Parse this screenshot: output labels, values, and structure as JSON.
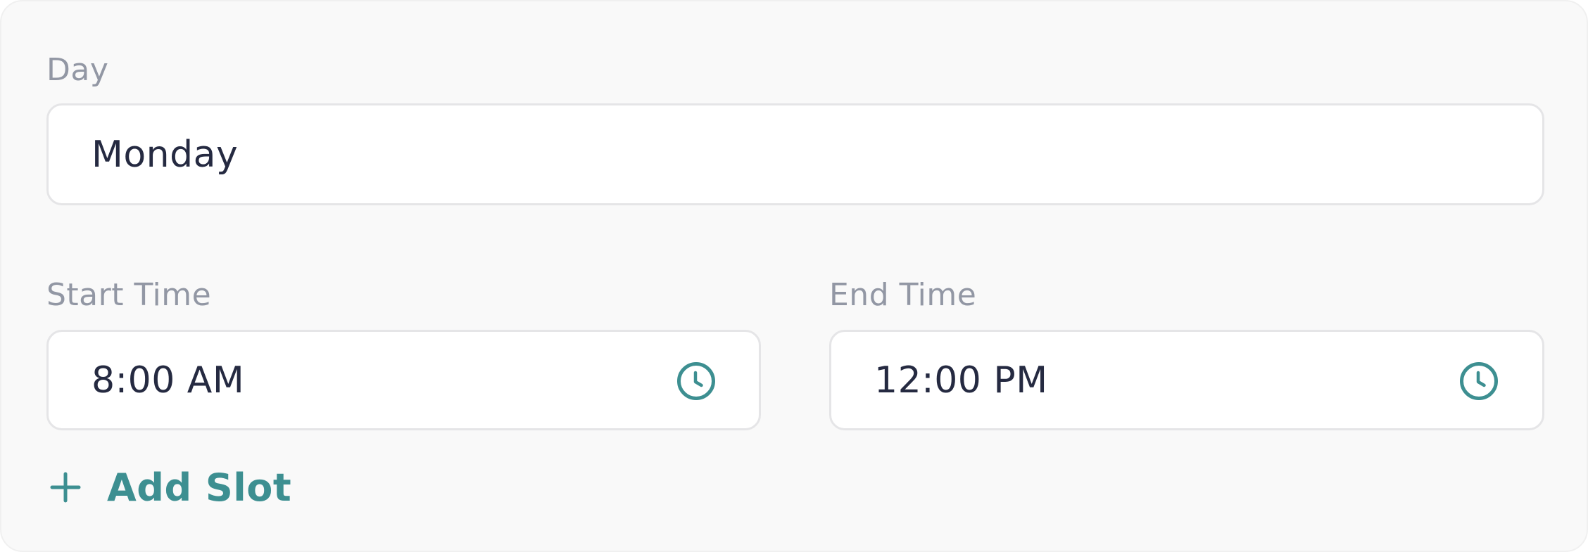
{
  "day": {
    "label": "Day",
    "value": "Monday"
  },
  "start_time": {
    "label": "Start Time",
    "value": "8:00 AM",
    "icon": "clock-icon"
  },
  "end_time": {
    "label": "End Time",
    "value": "12:00 PM",
    "icon": "clock-icon"
  },
  "add_slot": {
    "label": "Add Slot",
    "icon": "plus-icon"
  },
  "colors": {
    "accent": "#3d8f91",
    "label": "#9297a4",
    "value_text": "#252a41",
    "card_background": "#f9f9f9",
    "field_border": "#e5e5e7"
  }
}
